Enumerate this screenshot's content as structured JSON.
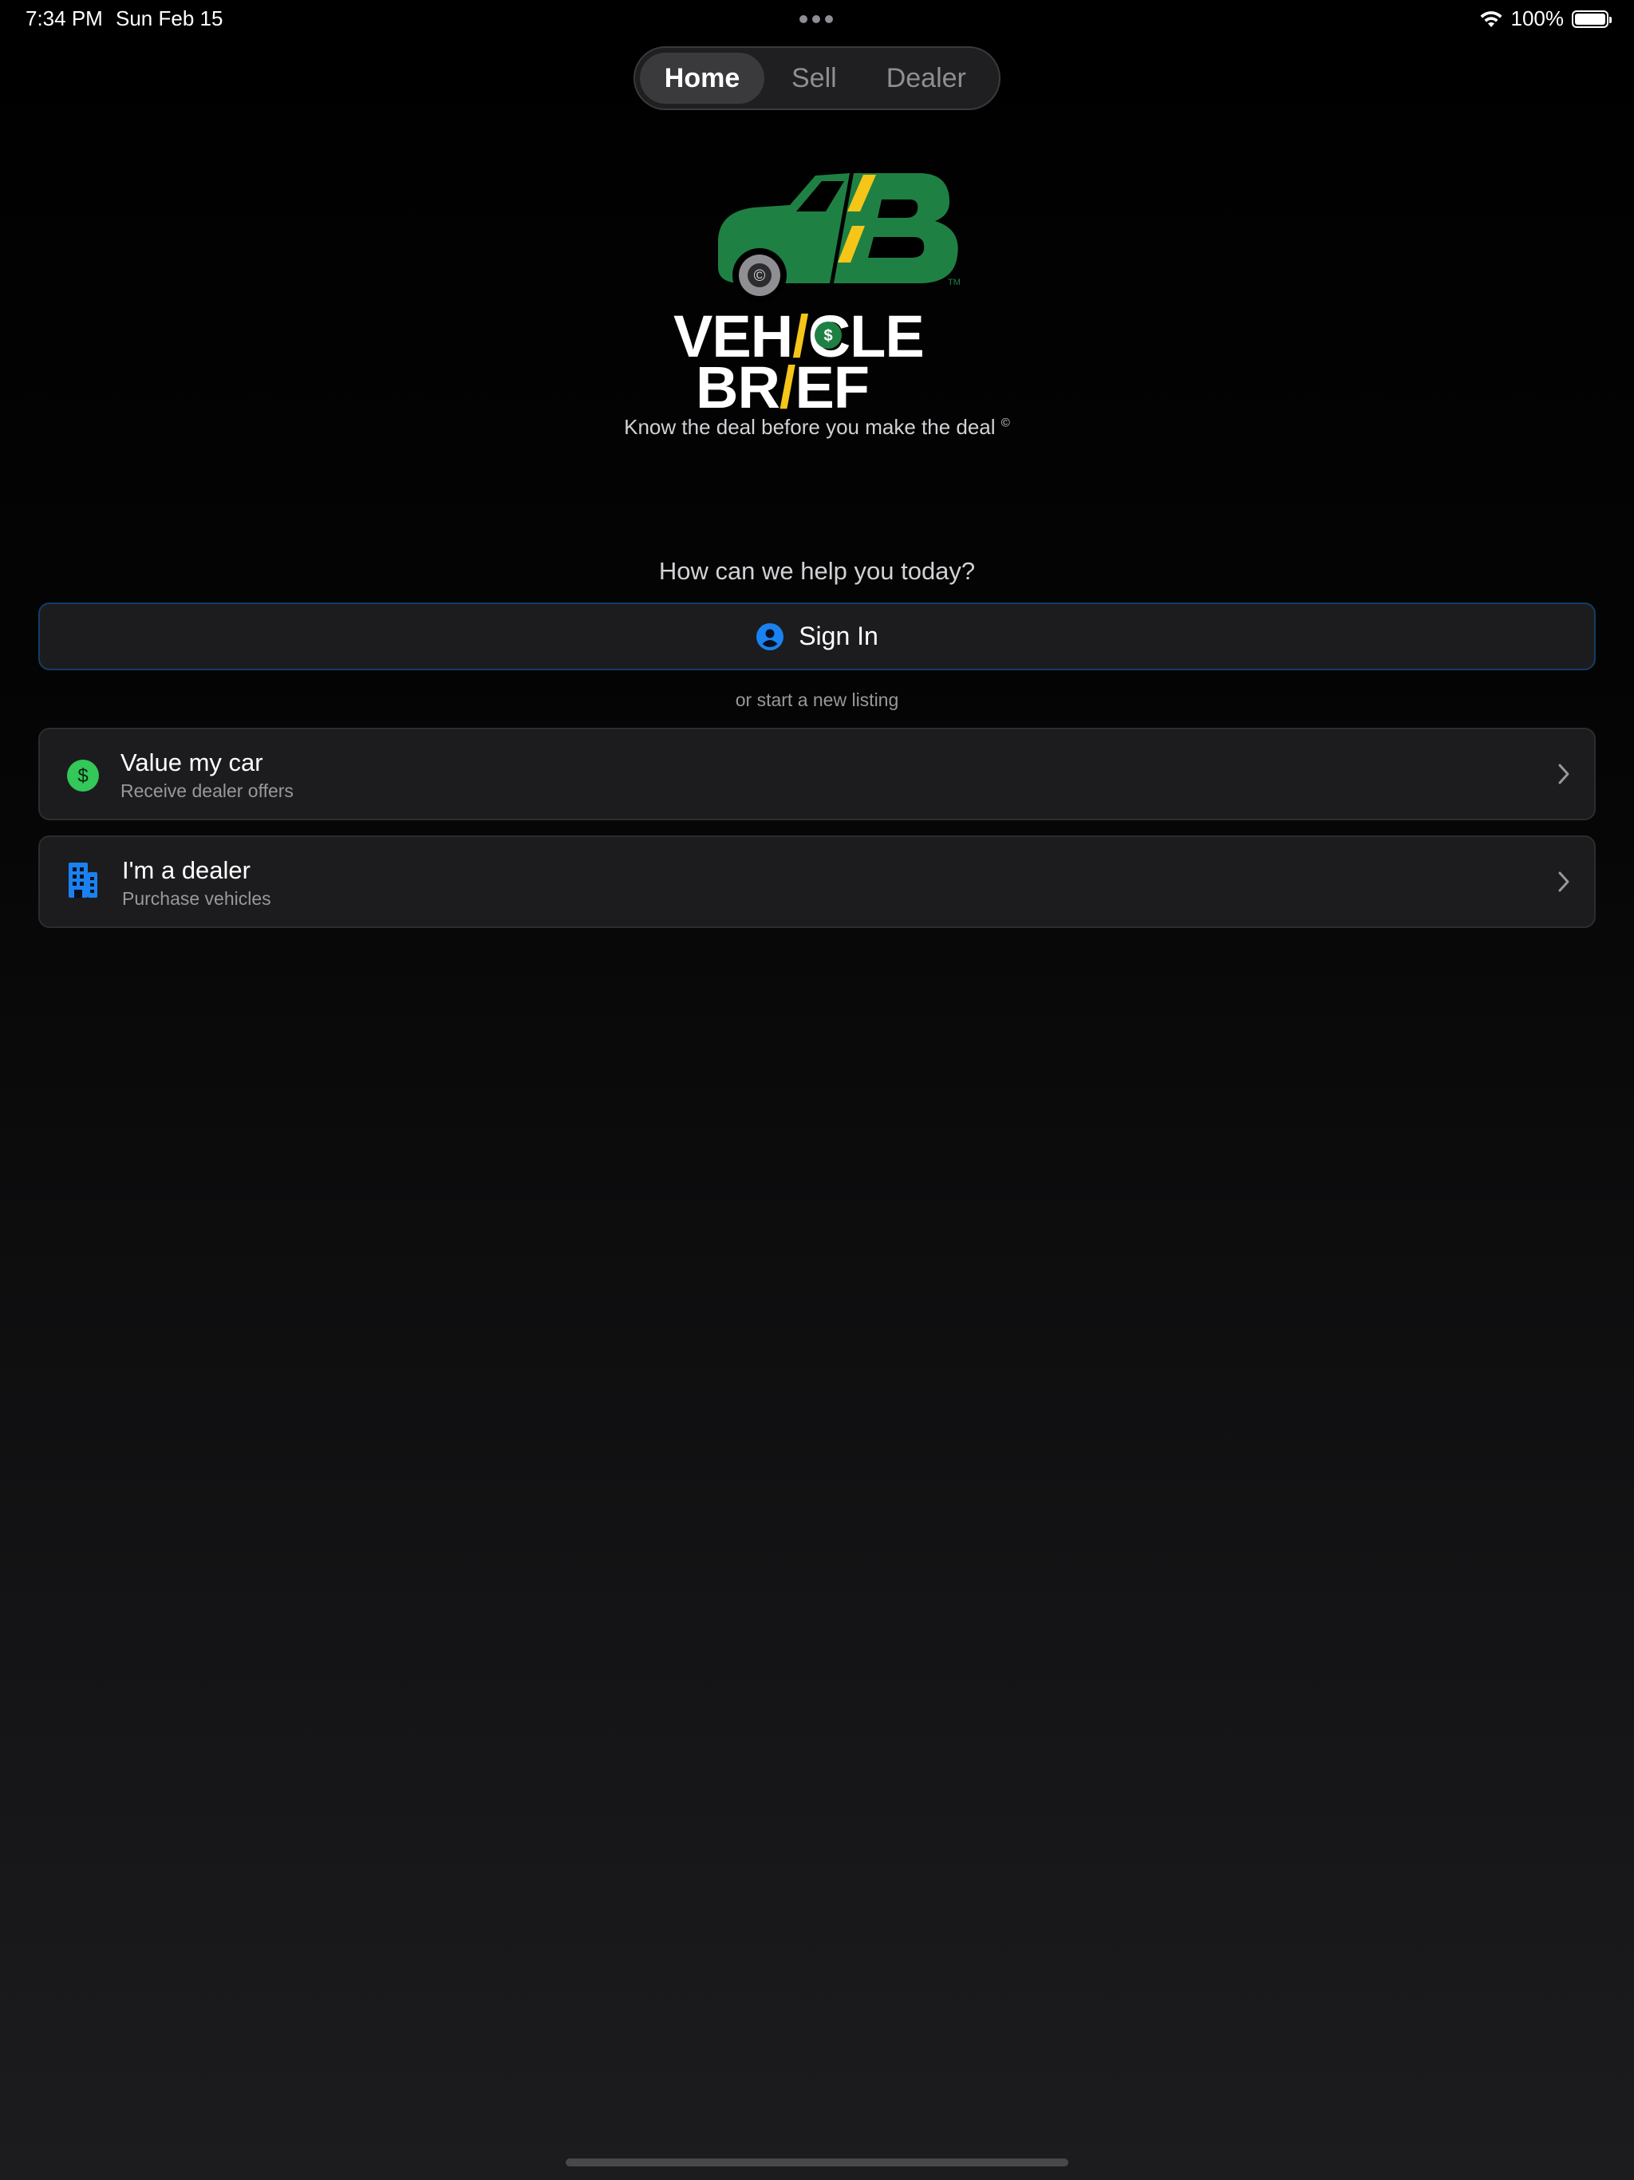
{
  "status_bar": {
    "time": "7:34 PM",
    "date": "Sun Feb 15",
    "battery_label": "100%",
    "battery_level": 1.0
  },
  "tabs": [
    {
      "label": "Home",
      "active": true
    },
    {
      "label": "Sell",
      "active": false
    },
    {
      "label": "Dealer",
      "active": false
    }
  ],
  "logo": {
    "line1_a": "VEH",
    "line1_b": "CLE",
    "line2_a": "BR",
    "line2_b": "EF",
    "tm": "TM"
  },
  "tagline": {
    "text": "Know the deal before you make the deal",
    "mark": "©"
  },
  "prompt": "How can we help you today?",
  "signin": {
    "label": "Sign In",
    "icon": "person-circle-icon"
  },
  "divider_text": "or start a new listing",
  "options": [
    {
      "title": "Value my car",
      "subtitle": "Receive dealer offers",
      "icon": "dollar-circle-icon"
    },
    {
      "title": "I'm a dealer",
      "subtitle": "Purchase vehicles",
      "icon": "building-icon"
    }
  ],
  "colors": {
    "brand_green": "#1f8044",
    "brand_yellow": "#f5c518",
    "accent_blue": "#1a82f0",
    "dollar_green": "#34c759"
  }
}
